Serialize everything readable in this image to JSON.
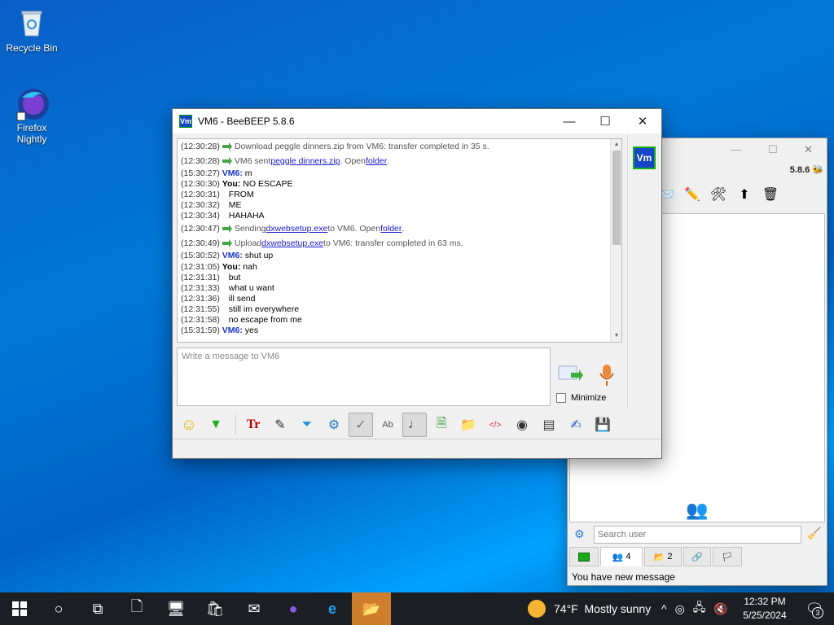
{
  "desktop": {
    "icons": [
      {
        "label": "Recycle Bin",
        "icon": "recycle-bin-icon"
      },
      {
        "label": "Firefox Nightly",
        "icon": "firefox-nightly-icon"
      }
    ]
  },
  "chat_window": {
    "title": "VM6 - BeeBEEP 5.8.6",
    "app_icon_text": "Vm",
    "avatar_text": "Vm",
    "log": [
      {
        "kind": "sys",
        "time": "(12:30:28)",
        "text": "Download peggle dinners.zip from VM6: transfer completed in 35 s."
      },
      {
        "kind": "sys",
        "time": "(12:30:28)",
        "pre": "VM6 sent ",
        "link1": "peggle dinners.zip",
        "mid": ". Open ",
        "link2": "folder",
        "post": "."
      },
      {
        "kind": "msg",
        "time": "(15:30:27)",
        "who": "VM6:",
        "who_type": "vm",
        "text": " m"
      },
      {
        "kind": "msg",
        "time": "(12:30:30)",
        "who": "You:",
        "who_type": "you",
        "text": " NO ESCAPE"
      },
      {
        "kind": "msg",
        "time": "(12:30:31)",
        "who": "",
        "who_type": "",
        "text": "FROM"
      },
      {
        "kind": "msg",
        "time": "(12:30:32)",
        "who": "",
        "who_type": "",
        "text": "ME"
      },
      {
        "kind": "msg",
        "time": "(12:30:34)",
        "who": "",
        "who_type": "",
        "text": "HAHAHA"
      },
      {
        "kind": "sys",
        "time": "(12:30:47)",
        "pre": "Sending ",
        "link1": "dxwebsetup.exe",
        "mid": " to VM6. Open ",
        "link2": "folder",
        "post": "."
      },
      {
        "kind": "sys",
        "time": "(12:30:49)",
        "pre": "Upload ",
        "link1": "dxwebsetup.exe",
        "mid": " to VM6: transfer completed in 63 ms.",
        "link2": "",
        "post": ""
      },
      {
        "kind": "msg",
        "time": "(15:30:52)",
        "who": "VM6:",
        "who_type": "vm",
        "text": " shut up"
      },
      {
        "kind": "msg",
        "time": "(12:31:05)",
        "who": "You:",
        "who_type": "you",
        "text": " nah"
      },
      {
        "kind": "msg",
        "time": "(12:31:31)",
        "who": "",
        "who_type": "",
        "text": "but"
      },
      {
        "kind": "msg",
        "time": "(12:31:33)",
        "who": "",
        "who_type": "",
        "text": "what u want"
      },
      {
        "kind": "msg",
        "time": "(12:31:36)",
        "who": "",
        "who_type": "",
        "text": "ill send"
      },
      {
        "kind": "msg",
        "time": "(12:31:55)",
        "who": "",
        "who_type": "",
        "text": "still im everywhere"
      },
      {
        "kind": "msg",
        "time": "(12:31:58)",
        "who": "",
        "who_type": "",
        "text": "no escape from me"
      },
      {
        "kind": "msg",
        "time": "(15:31:59)",
        "who": "VM6:",
        "who_type": "vm",
        "text": " yes"
      }
    ],
    "input_placeholder": "Write a message to VM6",
    "input_value": "",
    "minimize_label": "Minimize",
    "minimize_checked": false,
    "toolbar": [
      "emoticons-icon",
      "expand-icon",
      "font-icon",
      "color-icon",
      "filter-icon",
      "settings-icon",
      "spellcheck-icon",
      "word-complete-icon",
      "sound-icon",
      "save-chat-icon",
      "send-file-icon",
      "html-icon",
      "screenshot-icon",
      "private-icon",
      "notes-icon",
      "save-icon"
    ]
  },
  "main_window": {
    "version": "5.8.6",
    "search_placeholder": "Search user",
    "tabs": [
      {
        "icon": "chat-tab-icon",
        "count": ""
      },
      {
        "icon": "users-tab-icon",
        "count": "4"
      },
      {
        "icon": "groups-tab-icon",
        "count": "2"
      },
      {
        "icon": "network-tab-icon",
        "count": ""
      },
      {
        "icon": "share-tab-icon",
        "count": ""
      }
    ],
    "status": "You have new message"
  },
  "taskbar": {
    "weather_temp": "74°F",
    "weather_text": "Mostly sunny",
    "time": "12:32 PM",
    "date": "5/25/2024",
    "notifications": "3"
  }
}
